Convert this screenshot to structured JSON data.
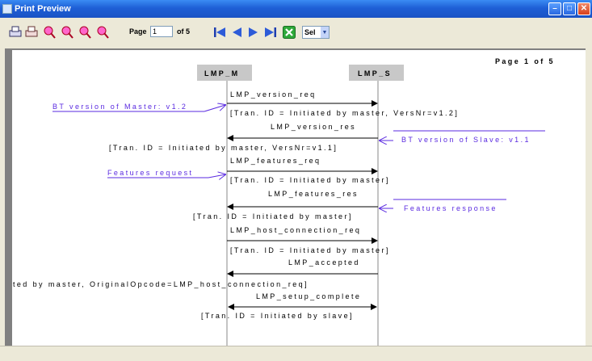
{
  "window": {
    "title": "Print Preview",
    "min_icon": "minimize-icon",
    "max_icon": "maximize-icon",
    "close_icon": "close-icon"
  },
  "toolbar": {
    "page_label": "Page",
    "page_value": "1",
    "of_label": "of 5",
    "select_value": "Sel",
    "icons": [
      "print-icon",
      "print-setup-icon",
      "zoom-in-icon",
      "zoom-out-icon",
      "zoom-fit-icon",
      "zoom-width-icon",
      "first-page-icon",
      "previous-page-icon",
      "next-page-icon",
      "last-page-icon",
      "close-preview-icon"
    ]
  },
  "page": {
    "header": "Page 1 of 5",
    "lifelines": [
      {
        "name": "LMP_M"
      },
      {
        "name": "LMP_S"
      }
    ],
    "messages": [
      {
        "label": "LMP_version_req",
        "direction": "right"
      },
      {
        "label": "[Tran. ID = Initiated by master, VersNr=v1.2]",
        "direction": "right"
      },
      {
        "label": "LMP_version_res",
        "direction": "left"
      },
      {
        "label": "[Tran. ID = Initiated by master, VersNr=v1.1]",
        "direction": "left"
      },
      {
        "label": "LMP_features_req",
        "direction": "right"
      },
      {
        "label": "[Tran. ID = Initiated by master]",
        "direction": "right"
      },
      {
        "label": "LMP_features_res",
        "direction": "left"
      },
      {
        "label": "[Tran. ID = Initiated by master]",
        "direction": "left"
      },
      {
        "label": "LMP_host_connection_req",
        "direction": "right"
      },
      {
        "label": "[Tran. ID = Initiated by master]",
        "direction": "right"
      },
      {
        "label": "LMP_accepted",
        "direction": "left"
      },
      {
        "label": "ted by master, OriginalOpcode=LMP_host_connection_req]",
        "direction": "left"
      },
      {
        "label": "LMP_setup_complete",
        "direction": "both"
      },
      {
        "label": "[Tran. ID = Initiated by slave]",
        "direction": "both"
      }
    ],
    "notes": [
      {
        "text": "BT version of Master: v1.2"
      },
      {
        "text": "BT version of Slave: v1.1"
      },
      {
        "text": "Features request"
      },
      {
        "text": "Features response"
      }
    ]
  }
}
